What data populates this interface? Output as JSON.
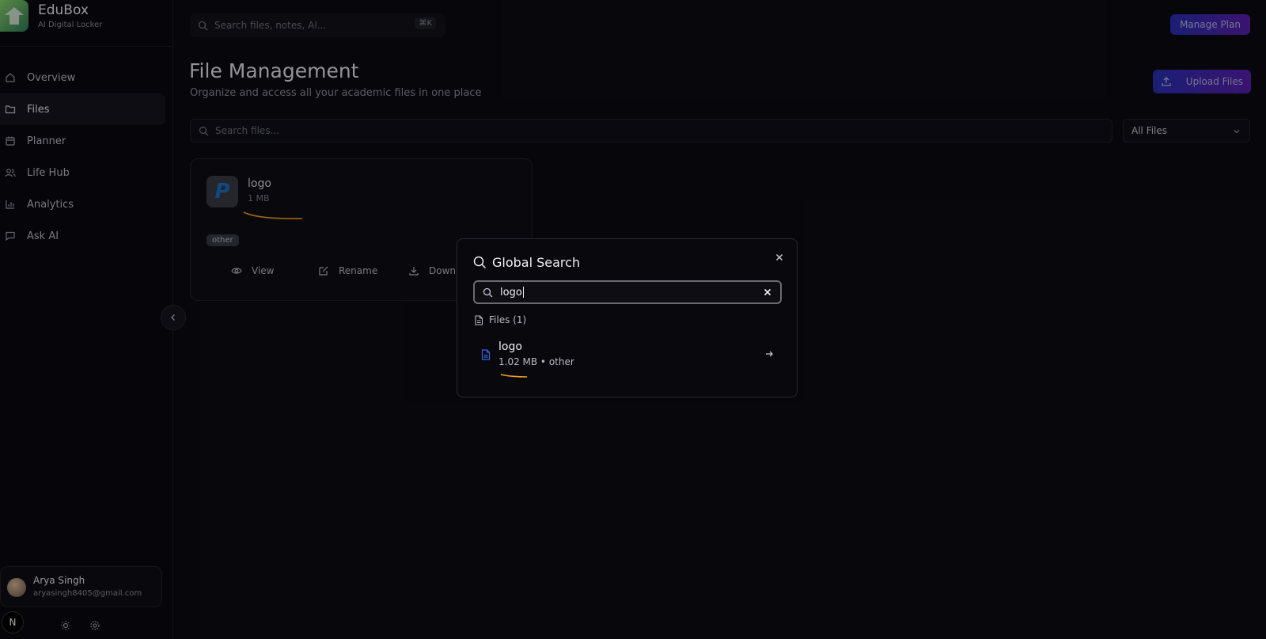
{
  "brand": {
    "name": "EduBox",
    "subtitle": "AI Digital Locker"
  },
  "nav": {
    "items": [
      {
        "label": "Overview",
        "icon": "home-icon"
      },
      {
        "label": "Files",
        "icon": "folder-icon",
        "active": true
      },
      {
        "label": "Planner",
        "icon": "calendar-icon"
      },
      {
        "label": "Life Hub",
        "icon": "users-icon"
      },
      {
        "label": "Analytics",
        "icon": "bar-chart-icon"
      },
      {
        "label": "Ask AI",
        "icon": "message-icon"
      }
    ]
  },
  "user": {
    "name": "Arya Singh",
    "email": "aryasingh8405@gmail.com",
    "badge": "N"
  },
  "topbar": {
    "search_placeholder": "Search files, notes, AI...",
    "shortcut": "⌘K",
    "manage_plan": "Manage Plan"
  },
  "page": {
    "title": "File Management",
    "subtitle": "Organize and access all your academic files in one place",
    "upload_label": "Upload Files"
  },
  "files_search": {
    "placeholder": "Search files..."
  },
  "filter": {
    "selected": "All Files"
  },
  "file_card": {
    "name": "logo",
    "size": "1 MB",
    "tag": "other",
    "thumb_letter": "P",
    "actions": {
      "view": "View",
      "rename": "Rename",
      "download": "Downl"
    }
  },
  "search_modal": {
    "title": "Global Search",
    "query": "logo",
    "section_label": "Files (1)",
    "results": [
      {
        "name": "logo",
        "meta": "1.02 MB • other"
      }
    ]
  },
  "colors": {
    "background": "#0b0b12",
    "accent_gradient_start": "#2a2fb4",
    "accent_gradient_end": "#5a1fae",
    "annotation": "#f0a020"
  }
}
